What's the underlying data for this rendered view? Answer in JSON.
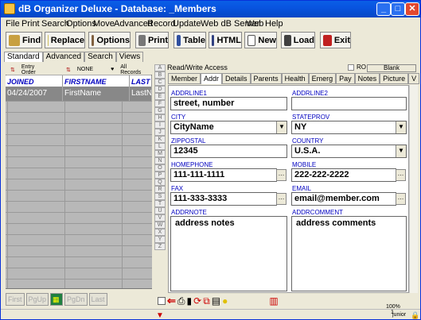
{
  "title": "dB Organizer Deluxe - Database: _Members",
  "menu": [
    "File",
    "Print",
    "Search",
    "Options",
    "Move",
    "Advanced",
    "Record",
    "Update",
    "Web dB Server",
    "Web",
    "Help"
  ],
  "toolbar": {
    "find": "Find",
    "replace": "Replace",
    "options": "Options",
    "print": "Print",
    "table": "Table",
    "html": "HTML",
    "new": "New",
    "load": "Load",
    "exit": "Exit"
  },
  "view_tabs": [
    "Standard",
    "Advanced",
    "Search",
    "Views"
  ],
  "sort": {
    "entry": "Entry Order",
    "none": "NONE",
    "all": "All Records"
  },
  "grid": {
    "headers": [
      "JOINED",
      "FIRSTNAME",
      "LAST"
    ],
    "row": [
      "04/24/2007",
      "FirstName",
      "LastN"
    ]
  },
  "nav": {
    "first": "First",
    "pgup": "PgUp",
    "pgdn": "PgDn",
    "last": "Last"
  },
  "alpha": [
    "A",
    "B",
    "C",
    "D",
    "E",
    "F",
    "G",
    "H",
    "I",
    "J",
    "K",
    "L",
    "M",
    "N",
    "O",
    "P",
    "Q",
    "R",
    "S",
    "T",
    "U",
    "V",
    "W",
    "X",
    "Y",
    "Z"
  ],
  "status": {
    "access": "Read/Write Access",
    "ro": "RO",
    "blank": "Blank",
    "user": "junior",
    "page": "1",
    "zoom": "100%"
  },
  "record_tabs": [
    "Member",
    "Addr",
    "Details",
    "Parents",
    "Health",
    "Emerg",
    "Pay",
    "Notes",
    "Picture",
    "V"
  ],
  "form": {
    "addrline1_label": "ADDRLINE1",
    "addrline1": "street, number",
    "addrline2_label": "ADDRLINE2",
    "addrline2": "",
    "city_label": "CITY",
    "city": "CityName",
    "state_label": "STATEPROV",
    "state": "NY",
    "zip_label": "ZIPPOSTAL",
    "zip": "12345",
    "country_label": "COUNTRY",
    "country": "U.S.A.",
    "homephone_label": "HOMEPHONE",
    "homephone": "111-111-1111",
    "mobile_label": "MOBILE",
    "mobile": "222-222-2222",
    "fax_label": "FAX",
    "fax": "111-333-3333",
    "email_label": "EMAIL",
    "email": "email@member.com",
    "addrnote_label": "ADDRNOTE",
    "addrnote": "address notes",
    "addrcomment_label": "ADDRCOMMENT",
    "addrcomment": "address comments"
  },
  "colors": {
    "titlebar": "#0854e0",
    "label": "#0000c0",
    "selected_row": "#888888"
  }
}
